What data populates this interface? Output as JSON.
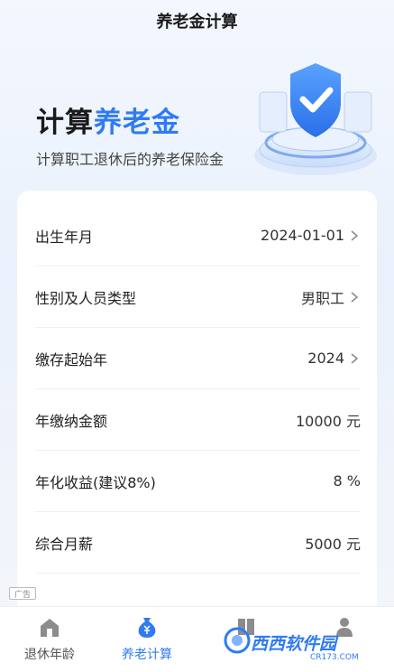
{
  "header": {
    "title": "养老金计算"
  },
  "hero": {
    "title_part1": "计算",
    "title_part2": "养老金",
    "subtitle": "计算职工退休后的养老保险金"
  },
  "form": {
    "rows": [
      {
        "label": "出生年月",
        "value": "2024-01-01",
        "has_chevron": true
      },
      {
        "label": "性别及人员类型",
        "value": "男职工",
        "has_chevron": true
      },
      {
        "label": "缴存起始年",
        "value": "2024",
        "has_chevron": true
      },
      {
        "label": "年缴纳金额",
        "value": "10000 元",
        "has_chevron": false
      },
      {
        "label": "年化收益(建议8%)",
        "value": "8 %",
        "has_chevron": false
      },
      {
        "label": "综合月薪",
        "value": "5000 元",
        "has_chevron": false
      }
    ]
  },
  "ad": {
    "label": "广告"
  },
  "tabbar": {
    "tabs": [
      {
        "label": "退休年龄",
        "icon": "house-icon",
        "active": false
      },
      {
        "label": "养老计算",
        "icon": "money-bag-icon",
        "active": true
      },
      {
        "label": "",
        "icon": "book-icon",
        "active": false
      },
      {
        "label": "",
        "icon": "person-icon",
        "active": false
      }
    ]
  },
  "watermark": {
    "text": "西西软件园",
    "sub": "CR173.COM"
  },
  "colors": {
    "accent": "#2f7bf5",
    "text": "#1a1a1a",
    "background": "#f3f7fe"
  }
}
